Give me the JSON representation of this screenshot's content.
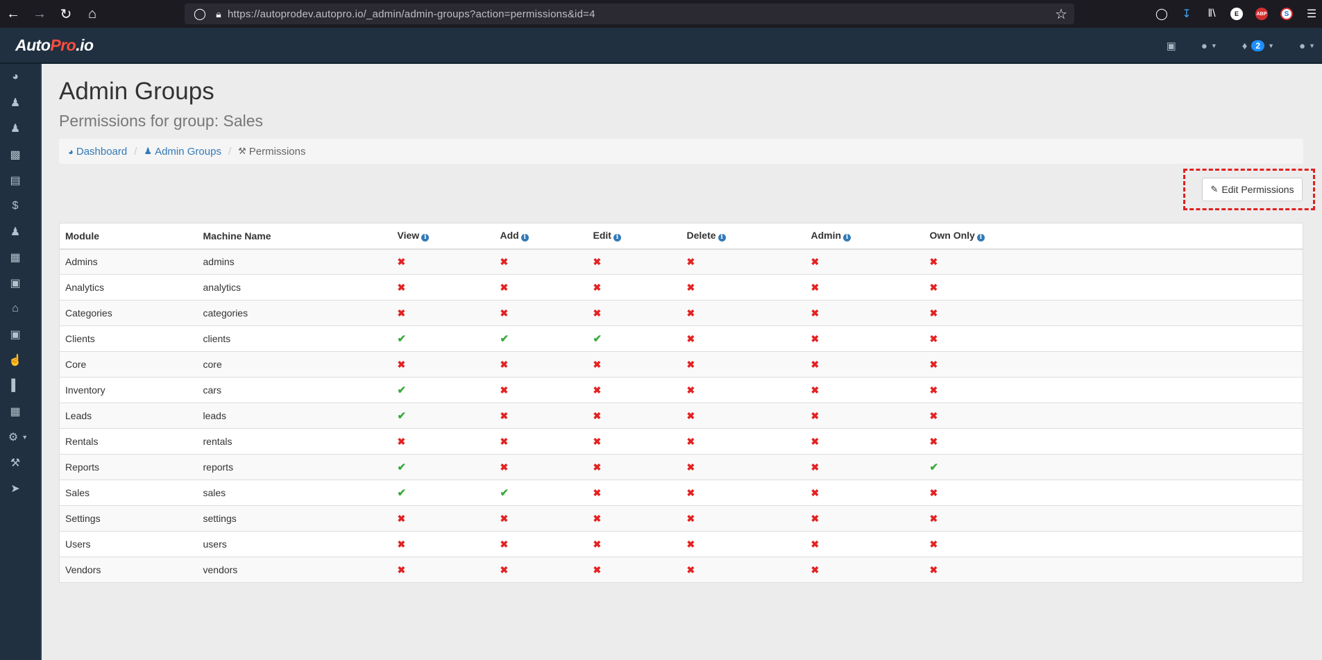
{
  "browser": {
    "url": "https://autoprodev.autopro.io/_admin/admin-groups?action=permissions&id=4"
  },
  "app": {
    "logo_part1": "Auto",
    "logo_part2": "Pro",
    "logo_part3": ".io",
    "notification_count": "2"
  },
  "page": {
    "title": "Admin Groups",
    "subtitle": "Permissions for group: Sales"
  },
  "breadcrumb": {
    "dashboard": "Dashboard",
    "admin_groups": "Admin Groups",
    "current": "Permissions"
  },
  "actions": {
    "edit_permissions": "Edit Permissions"
  },
  "table": {
    "headers": [
      "Module",
      "Machine Name",
      "View",
      "Add",
      "Edit",
      "Delete",
      "Admin",
      "Own Only"
    ],
    "rows": [
      {
        "module": "Admins",
        "machine": "admins",
        "perms": [
          false,
          false,
          false,
          false,
          false,
          false
        ]
      },
      {
        "module": "Analytics",
        "machine": "analytics",
        "perms": [
          false,
          false,
          false,
          false,
          false,
          false
        ]
      },
      {
        "module": "Categories",
        "machine": "categories",
        "perms": [
          false,
          false,
          false,
          false,
          false,
          false
        ]
      },
      {
        "module": "Clients",
        "machine": "clients",
        "perms": [
          true,
          true,
          true,
          false,
          false,
          false
        ]
      },
      {
        "module": "Core",
        "machine": "core",
        "perms": [
          false,
          false,
          false,
          false,
          false,
          false
        ]
      },
      {
        "module": "Inventory",
        "machine": "cars",
        "perms": [
          true,
          false,
          false,
          false,
          false,
          false
        ]
      },
      {
        "module": "Leads",
        "machine": "leads",
        "perms": [
          true,
          false,
          false,
          false,
          false,
          false
        ]
      },
      {
        "module": "Rentals",
        "machine": "rentals",
        "perms": [
          false,
          false,
          false,
          false,
          false,
          false
        ]
      },
      {
        "module": "Reports",
        "machine": "reports",
        "perms": [
          true,
          false,
          false,
          false,
          false,
          true
        ]
      },
      {
        "module": "Sales",
        "machine": "sales",
        "perms": [
          true,
          true,
          false,
          false,
          false,
          false
        ]
      },
      {
        "module": "Settings",
        "machine": "settings",
        "perms": [
          false,
          false,
          false,
          false,
          false,
          false
        ]
      },
      {
        "module": "Users",
        "machine": "users",
        "perms": [
          false,
          false,
          false,
          false,
          false,
          false
        ]
      },
      {
        "module": "Vendors",
        "machine": "vendors",
        "perms": [
          false,
          false,
          false,
          false,
          false,
          false
        ]
      }
    ]
  },
  "icons": {
    "sidebar": [
      "dashboard-icon",
      "groups-icon",
      "users-icon",
      "car-icon",
      "id-card-icon",
      "dollar-icon",
      "clients-icon",
      "calendar-icon",
      "money-icon",
      "bank-icon",
      "cash-icon",
      "thumbs-up-icon",
      "bar-chart-icon",
      "table-icon",
      "gear-icon",
      "wrench-icon",
      "rocket-icon"
    ],
    "yes": "check-icon",
    "no": "cross-icon"
  },
  "colors": {
    "header_bg": "#203040",
    "link": "#337ab7",
    "yes": "#3aaa3a",
    "no": "#e32222",
    "highlight": "#e02020"
  }
}
